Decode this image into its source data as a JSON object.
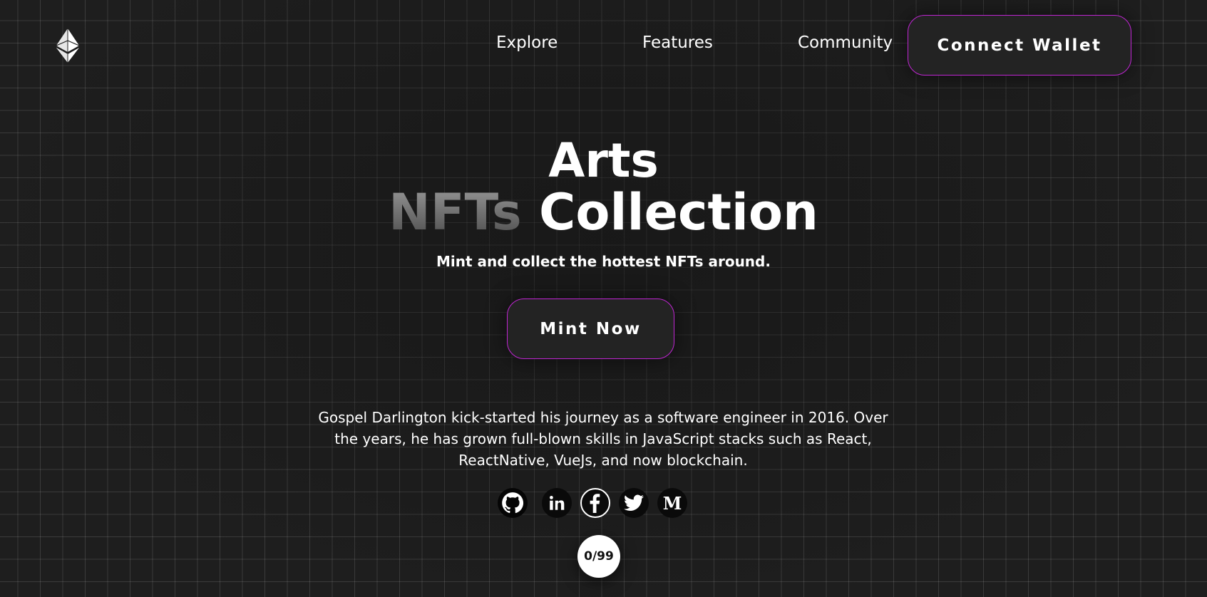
{
  "header": {
    "logo_icon": "ethereum-icon",
    "nav": [
      {
        "label": "Explore"
      },
      {
        "label": "Features"
      },
      {
        "label": "Community"
      }
    ],
    "connect_label": "Connect Wallet"
  },
  "hero": {
    "title_line1": "Arts",
    "title_line2_a": "NFTs",
    "title_line2_b": "Collection",
    "tagline": "Mint and collect the hottest NFTs around.",
    "mint_label": "Mint Now"
  },
  "bio": {
    "text": "Gospel Darlington kick-started his journey as a software engineer in 2016. Over the years, he has grown full-blown skills in JavaScript stacks such as React, ReactNative, VueJs, and now blockchain."
  },
  "socials": [
    {
      "icon": "github-icon"
    },
    {
      "icon": "linkedin-icon"
    },
    {
      "icon": "facebook-icon"
    },
    {
      "icon": "twitter-icon"
    },
    {
      "icon": "medium-icon"
    }
  ],
  "counter": {
    "text": "0/99"
  },
  "colors": {
    "background": "#1e1e1e",
    "accent_border": "#c026d3",
    "button_bg": "#232323",
    "text": "#ffffff"
  }
}
